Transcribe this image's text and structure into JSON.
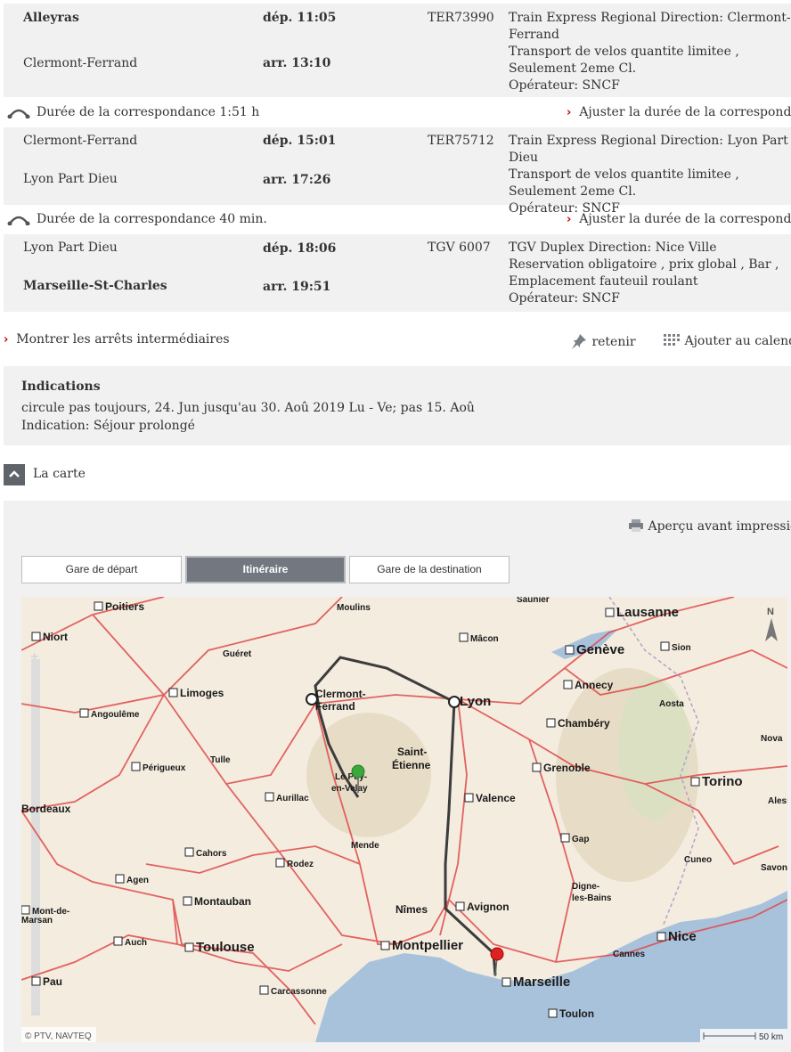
{
  "legs": [
    {
      "from": "Alleyras",
      "from_bold": true,
      "to": "Clermont-Ferrand",
      "to_bold": false,
      "dep": "dép. 11:05",
      "arr": "arr. 13:10",
      "train": "TER73990",
      "info": [
        "Train Express Regional Direction: Clermont-Ferrand",
        "Transport de velos quantite limitee , Seulement 2eme Cl.",
        "Opérateur: SNCF"
      ]
    },
    {
      "from": "Clermont-Ferrand",
      "from_bold": false,
      "to": "Lyon Part Dieu",
      "to_bold": false,
      "dep": "dép. 15:01",
      "arr": "arr. 17:26",
      "train": "TER75712",
      "info": [
        "Train Express Regional Direction: Lyon Part Dieu",
        "Transport de velos quantite limitee , Seulement 2eme Cl.",
        "Opérateur: SNCF"
      ]
    },
    {
      "from": "Lyon Part Dieu",
      "from_bold": false,
      "to": "Marseille-St-Charles",
      "to_bold": true,
      "dep": "dép. 18:06",
      "arr": "arr. 19:51",
      "train": "TGV 6007",
      "info": [
        "TGV Duplex Direction: Nice Ville",
        "Reservation obligatoire , prix global , Bar , Emplacement fauteuil roulant",
        "Opérateur: SNCF"
      ]
    }
  ],
  "connections": [
    {
      "duration": "Durée de la correspondance 1:51 h",
      "adjust": "Ajuster la durée de la correspondance"
    },
    {
      "duration": "Durée de la correspondance 40 min.",
      "adjust": "Ajuster la durée de la correspondance"
    }
  ],
  "actions": {
    "show_stops": "Montrer les arrêts intermédiaires",
    "retain": "retenir",
    "calendar": "Ajouter au calendrier"
  },
  "indications": {
    "title": "Indications",
    "lines": [
      "circule pas toujours, 24. Jun jusqu'au 30. Aoû 2019 Lu - Ve; pas 15. Aoû",
      "Indication: Séjour prolongé"
    ]
  },
  "map_section": {
    "toggle_label": "La carte",
    "print_preview": "Aperçu avant impression",
    "tabs": [
      "Gare de départ",
      "Itinéraire",
      "Gare de la destination"
    ],
    "active_tab": 1,
    "copyright": "© PTV, NAVTEQ",
    "scale": "50 km",
    "north": "N"
  },
  "map_labels": [
    {
      "t": "Poitiers",
      "c": "city-lbl"
    },
    {
      "t": "Niort",
      "c": "city-lbl"
    },
    {
      "t": "Guéret",
      "c": "city-sm"
    },
    {
      "t": "Moulins",
      "c": "city-sm"
    },
    {
      "t": "Saunier",
      "c": "city-sm"
    },
    {
      "t": "Lausanne",
      "c": "city-big"
    },
    {
      "t": "Mâcon",
      "c": "city-sm"
    },
    {
      "t": "Genève",
      "c": "city-big"
    },
    {
      "t": "Sion",
      "c": "city-sm"
    },
    {
      "t": "Limoges",
      "c": "city-lbl"
    },
    {
      "t": "Clermont-",
      "c": "city-lbl"
    },
    {
      "t": "Ferrand",
      "c": "city-lbl"
    },
    {
      "t": "Lyon",
      "c": "city-big"
    },
    {
      "t": "Annecy",
      "c": "city-lbl"
    },
    {
      "t": "Angoulême",
      "c": "city-sm"
    },
    {
      "t": "Aosta",
      "c": "city-sm"
    },
    {
      "t": "Chambéry",
      "c": "city-lbl"
    },
    {
      "t": "Nova",
      "c": "city-sm"
    },
    {
      "t": "Saint-",
      "c": "city-lbl"
    },
    {
      "t": "Étienne",
      "c": "city-lbl"
    },
    {
      "t": "Tulle",
      "c": "city-sm"
    },
    {
      "t": "Périgueux",
      "c": "city-sm"
    },
    {
      "t": "Grenoble",
      "c": "city-lbl"
    },
    {
      "t": "Le Puy-",
      "c": "city-sm"
    },
    {
      "t": "en-Velay",
      "c": "city-sm"
    },
    {
      "t": "Torino",
      "c": "city-big"
    },
    {
      "t": "Aurillac",
      "c": "city-sm"
    },
    {
      "t": "Valence",
      "c": "city-lbl"
    },
    {
      "t": "Bordeaux",
      "c": "city-lbl"
    },
    {
      "t": "Aless",
      "c": "city-sm"
    },
    {
      "t": "Gap",
      "c": "city-sm"
    },
    {
      "t": "Mende",
      "c": "city-sm"
    },
    {
      "t": "Cahors",
      "c": "city-sm"
    },
    {
      "t": "Rodez",
      "c": "city-sm"
    },
    {
      "t": "Cuneo",
      "c": "city-sm"
    },
    {
      "t": "Savona",
      "c": "city-sm"
    },
    {
      "t": "Agen",
      "c": "city-sm"
    },
    {
      "t": "Digne-",
      "c": "city-sm"
    },
    {
      "t": "les-Bains",
      "c": "city-sm"
    },
    {
      "t": "Mont-de-",
      "c": "city-sm"
    },
    {
      "t": "Marsan",
      "c": "city-sm"
    },
    {
      "t": "Montauban",
      "c": "city-lbl"
    },
    {
      "t": "Nîmes",
      "c": "city-lbl"
    },
    {
      "t": "Avignon",
      "c": "city-lbl"
    },
    {
      "t": "Auch",
      "c": "city-sm"
    },
    {
      "t": "Nice",
      "c": "city-big"
    },
    {
      "t": "Toulouse",
      "c": "city-big"
    },
    {
      "t": "Montpellier",
      "c": "city-big"
    },
    {
      "t": "Cannes",
      "c": "city-sm"
    },
    {
      "t": "Pau",
      "c": "city-lbl"
    },
    {
      "t": "Marseille",
      "c": "city-big"
    },
    {
      "t": "Carcassonne",
      "c": "city-sm"
    },
    {
      "t": "Toulon",
      "c": "city-lbl"
    }
  ],
  "colors": {
    "row_bg": "#f1f1f1",
    "accent_red": "#cc0000",
    "tab_active": "#737880",
    "route": "#3c3c3c",
    "land": "#f3ecdf",
    "sea": "#a9c2dc"
  }
}
